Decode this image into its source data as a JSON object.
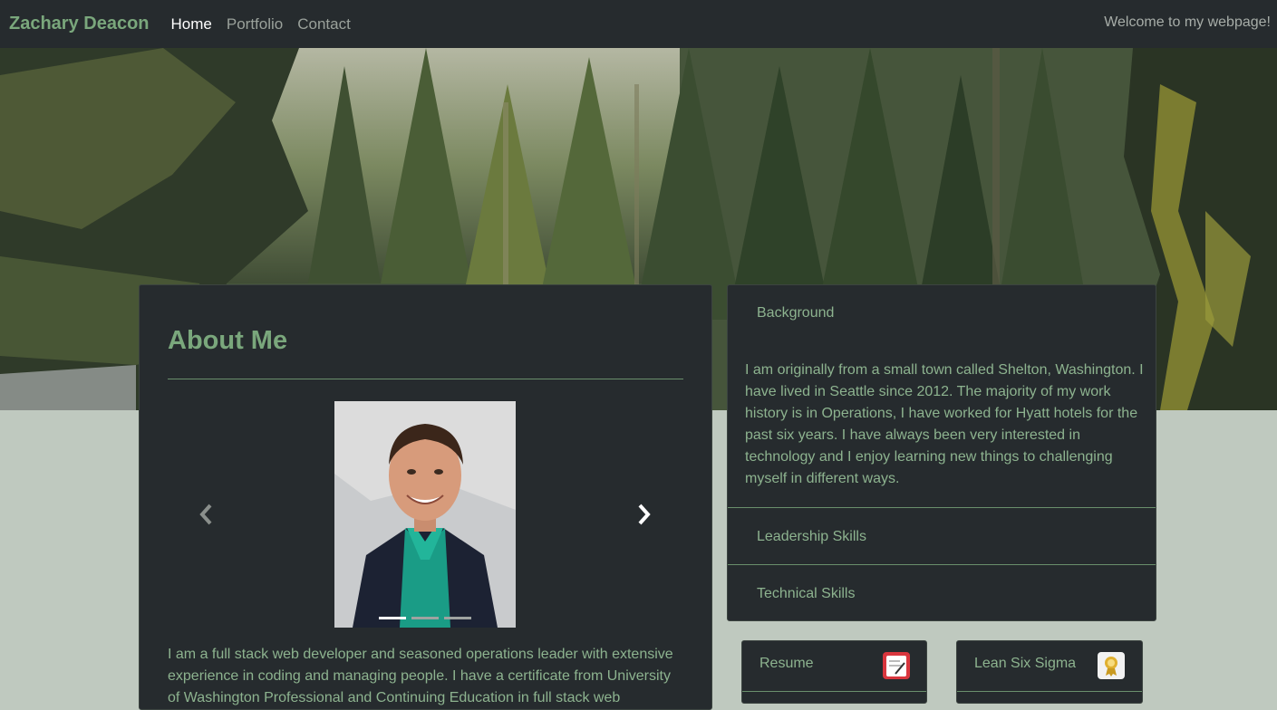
{
  "navbar": {
    "brand": "Zachary Deacon",
    "links": [
      "Home",
      "Portfolio",
      "Contact"
    ],
    "welcome": "Welcome to my webpage!"
  },
  "about": {
    "title": "About Me",
    "text": "I am a full stack web developer and seasoned operations leader with extensive experience in coding and managing people. I have a certificate from University of Washington Professional and Continuing Education in full stack web",
    "carousel": {
      "slide_count": 3,
      "active_slide": 1
    }
  },
  "accordion": {
    "background_title": "Background",
    "background_text": "I am originally from a small town called Shelton, Washington. I have lived in Seattle since 2012. The majority of my work history is in Operations, I have worked for Hyatt hotels for the past six years. I have always been very interested in technology and I enjoy learning new things to challenging myself in different ways.",
    "leadership_title": "Leadership Skills",
    "technical_title": "Technical Skills"
  },
  "tiles": {
    "resume": "Resume",
    "lean": "Lean Six Sigma"
  },
  "colors": {
    "accent": "#7aa77c",
    "text_green": "#8db38f",
    "panel": "#262b2e",
    "page_bg": "#bfc9bf"
  }
}
